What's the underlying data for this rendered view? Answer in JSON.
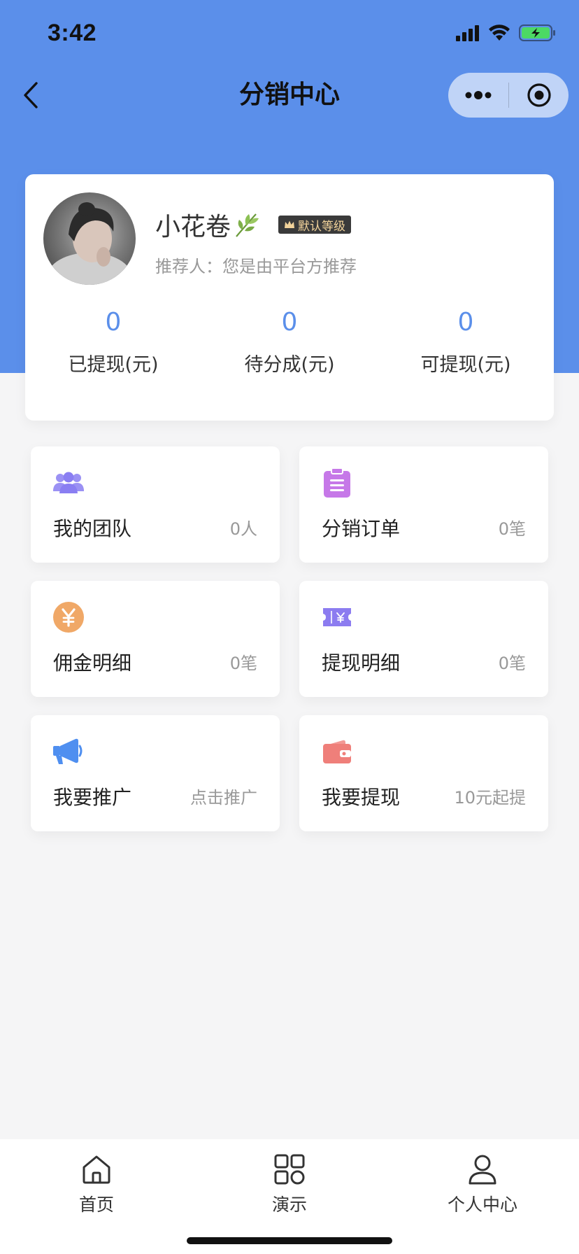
{
  "status_bar": {
    "time": "3:42"
  },
  "nav": {
    "title": "分销中心"
  },
  "profile": {
    "name": "小花卷",
    "level_badge": "默认等级",
    "referrer": "推荐人：您是由平台方推荐"
  },
  "stats": [
    {
      "value": "0",
      "label": "已提现(元)"
    },
    {
      "value": "0",
      "label": "待分成(元)"
    },
    {
      "value": "0",
      "label": "可提现(元)"
    }
  ],
  "menu": [
    {
      "title": "我的团队",
      "meta": "0人",
      "icon": "team-icon",
      "color": "#8a7ef2"
    },
    {
      "title": "分销订单",
      "meta": "0笔",
      "icon": "clipboard-icon",
      "color": "#c678e8"
    },
    {
      "title": "佣金明细",
      "meta": "0笔",
      "icon": "yen-coin-icon",
      "color": "#f0a867"
    },
    {
      "title": "提现明细",
      "meta": "0笔",
      "icon": "yen-ticket-icon",
      "color": "#8c7cf0"
    },
    {
      "title": "我要推广",
      "meta": "点击推广",
      "icon": "megaphone-icon",
      "color": "#4f8ff0"
    },
    {
      "title": "我要提现",
      "meta": "10元起提",
      "icon": "wallet-icon",
      "color": "#ef7f7a"
    }
  ],
  "tabbar": [
    {
      "label": "首页",
      "icon": "home-icon"
    },
    {
      "label": "演示",
      "icon": "grid-icon"
    },
    {
      "label": "个人中心",
      "icon": "person-icon"
    }
  ],
  "colors": {
    "primary": "#5b8fea",
    "background": "#f5f5f6",
    "badge_bg": "#3a3a3a",
    "badge_text": "#f2d39b"
  }
}
